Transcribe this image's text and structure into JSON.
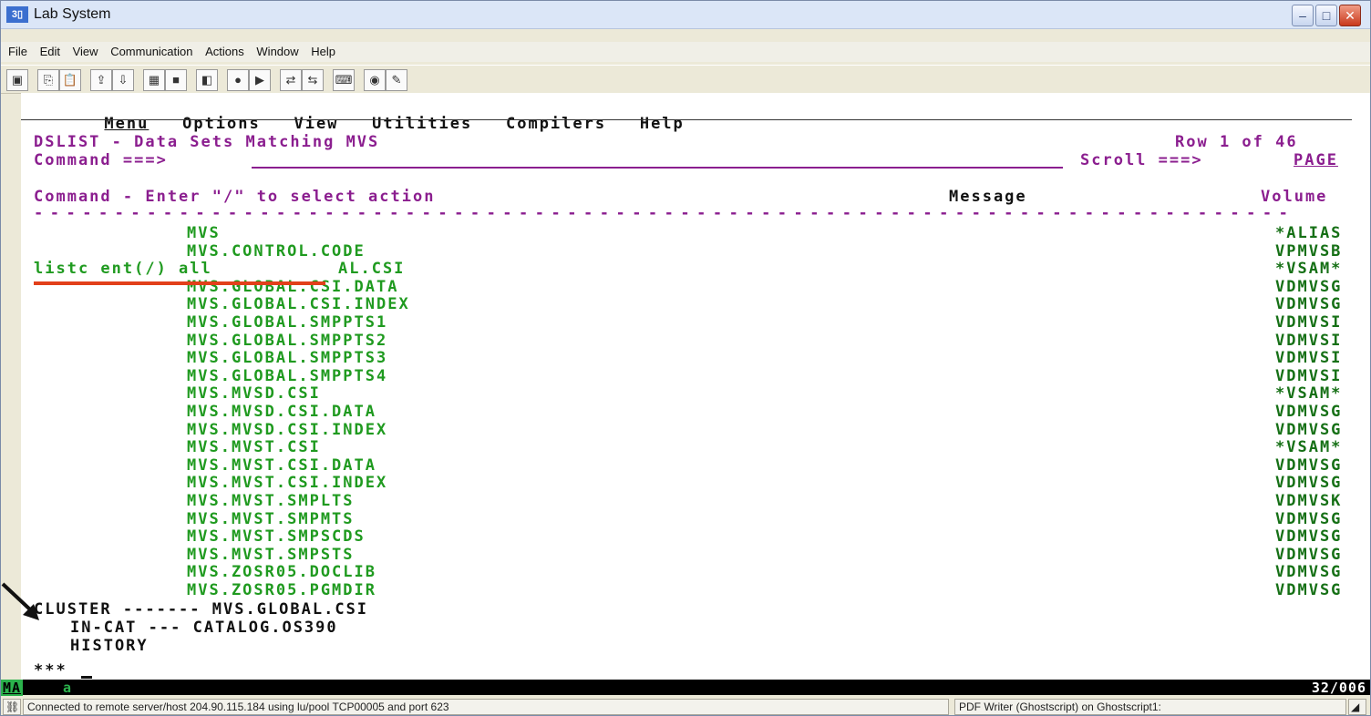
{
  "window": {
    "title": "Lab System",
    "app_icon": "3270-app-icon"
  },
  "menubar": {
    "items": [
      "File",
      "Edit",
      "View",
      "Communication",
      "Actions",
      "Window",
      "Help"
    ]
  },
  "ispf_menu": {
    "items": [
      "Menu",
      "Options",
      "View",
      "Utilities",
      "Compilers",
      "Help"
    ]
  },
  "panel": {
    "title": "DSLIST - Data Sets Matching MVS",
    "row_info": "Row 1 of 46",
    "command_label": "Command ===>",
    "command_value": "",
    "scroll_label": "Scroll ===>",
    "scroll_value": "PAGE",
    "header_left": "Command - Enter \"/\" to select action",
    "header_message": "Message",
    "header_volume": "Volume",
    "separator": "------------------------------------------------------------------------------"
  },
  "rows": [
    {
      "cmd": "",
      "name": "MVS",
      "volume": "*ALIAS"
    },
    {
      "cmd": "",
      "name": "MVS.CONTROL.CODE",
      "volume": "VPMVSB"
    },
    {
      "cmd": "listc ent(/) all",
      "name": "AL.CSI",
      "volume": "*VSAM*"
    },
    {
      "cmd": "",
      "name": "MVS.GLOBAL.CSI.DATA",
      "volume": "VDMVSG"
    },
    {
      "cmd": "",
      "name": "MVS.GLOBAL.CSI.INDEX",
      "volume": "VDMVSG"
    },
    {
      "cmd": "",
      "name": "MVS.GLOBAL.SMPPTS1",
      "volume": "VDMVSI"
    },
    {
      "cmd": "",
      "name": "MVS.GLOBAL.SMPPTS2",
      "volume": "VDMVSI"
    },
    {
      "cmd": "",
      "name": "MVS.GLOBAL.SMPPTS3",
      "volume": "VDMVSI"
    },
    {
      "cmd": "",
      "name": "MVS.GLOBAL.SMPPTS4",
      "volume": "VDMVSI"
    },
    {
      "cmd": "",
      "name": "MVS.MVSD.CSI",
      "volume": "*VSAM*"
    },
    {
      "cmd": "",
      "name": "MVS.MVSD.CSI.DATA",
      "volume": "VDMVSG"
    },
    {
      "cmd": "",
      "name": "MVS.MVSD.CSI.INDEX",
      "volume": "VDMVSG"
    },
    {
      "cmd": "",
      "name": "MVS.MVST.CSI",
      "volume": "*VSAM*"
    },
    {
      "cmd": "",
      "name": "MVS.MVST.CSI.DATA",
      "volume": "VDMVSG"
    },
    {
      "cmd": "",
      "name": "MVS.MVST.CSI.INDEX",
      "volume": "VDMVSG"
    },
    {
      "cmd": "",
      "name": "MVS.MVST.SMPLTS",
      "volume": "VDMVSK"
    },
    {
      "cmd": "",
      "name": "MVS.MVST.SMPMTS",
      "volume": "VDMVSG"
    },
    {
      "cmd": "",
      "name": "MVS.MVST.SMPSCDS",
      "volume": "VDMVSG"
    },
    {
      "cmd": "",
      "name": "MVS.MVST.SMPSTS",
      "volume": "VDMVSG"
    },
    {
      "cmd": "",
      "name": "MVS.ZOSR05.DOCLIB",
      "volume": "VDMVSG"
    },
    {
      "cmd": "",
      "name": "MVS.ZOSR05.PGMDIR",
      "volume": "VDMVSG"
    }
  ],
  "output": {
    "line1": "CLUSTER ------- MVS.GLOBAL.CSI",
    "line2": "IN-CAT --- CATALOG.OS390",
    "line3": "HISTORY",
    "line4": "***"
  },
  "oia": {
    "left": "MA",
    "mid": "a",
    "cursor": "32/006"
  },
  "statusbar": {
    "connection": "Connected to remote server/host 204.90.115.184 using lu/pool TCP00005 and port 623",
    "printer": "PDF Writer (Ghostscript) on Ghostscript1:"
  },
  "colors": {
    "panel_magenta": "#8b1e8f",
    "dataset_green": "#1f9a1f",
    "annotation_red": "#e2401a"
  }
}
